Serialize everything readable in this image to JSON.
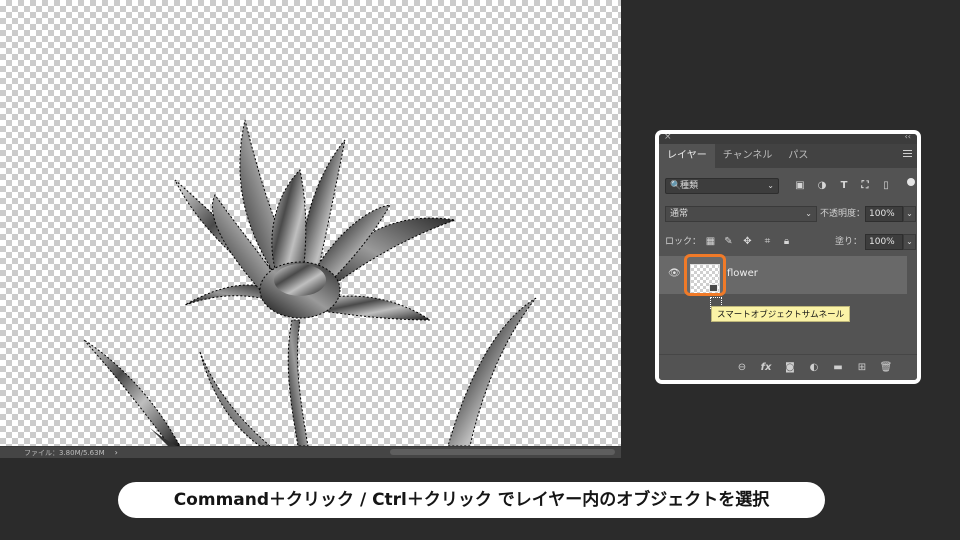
{
  "status_bar": {
    "doc_size": "ファイル：3.80M/5.63M",
    "arrow": "›"
  },
  "panel": {
    "close_glyph": "×",
    "collapse_glyph": "‹‹",
    "tabs": [
      {
        "label": "レイヤー",
        "active": true
      },
      {
        "label": "チャンネル",
        "active": false
      },
      {
        "label": "パス",
        "active": false
      }
    ],
    "filter": {
      "search_icon": "🔍",
      "kind": "種類",
      "dropdown": "⌄"
    },
    "filter_icons": [
      "image-filter-icon",
      "adjustment-filter-icon",
      "type-filter-icon",
      "shape-filter-icon",
      "smart-object-filter-icon"
    ],
    "blend_mode": "通常",
    "opacity_label": "不透明度：",
    "opacity_value": "100%",
    "lock_label": "ロック：",
    "fill_label": "塗り：",
    "fill_value": "100%",
    "layer": {
      "name": "flower",
      "visible": true
    },
    "tooltip": "スマートオブジェクトサムネール",
    "bottom_icons": [
      "link-layers-icon",
      "fx-icon",
      "layer-mask-icon",
      "adjustment-layer-icon",
      "group-folder-icon",
      "new-layer-icon",
      "trash-icon"
    ]
  },
  "caption": "Command＋クリック / Ctrl＋クリック でレイヤー内のオブジェクトを選択",
  "colors": {
    "highlight": "#f07a28",
    "tooltip_bg": "#fbf3a6",
    "panel_bg": "#535353",
    "selected_layer": "#696969"
  }
}
